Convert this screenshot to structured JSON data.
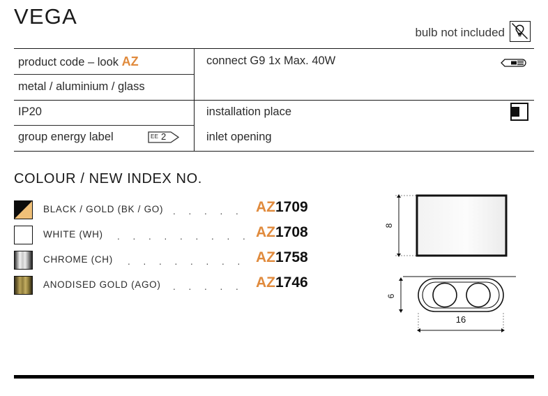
{
  "product": {
    "title": "VEGA",
    "bulb_note": "bulb not included"
  },
  "spec_table": {
    "left_column": [
      {
        "label": "product code – look ",
        "highlight": "AZ"
      },
      {
        "label": "metal / aluminium / glass"
      },
      {
        "label": "IP20"
      },
      {
        "label": "group energy label"
      }
    ],
    "right_column": [
      {
        "label": "connect G9 1x Max. 40W"
      },
      {
        "label": "installation place"
      },
      {
        "label": "inlet opening"
      }
    ],
    "energy_label": {
      "prefix": "EE",
      "value": "2"
    },
    "icons": {
      "bulb_not_included": "bulb-crossed-icon",
      "lamp_socket": "g9-capsule-lamp-icon",
      "installation_place": "wall-mount-icon"
    }
  },
  "colour_section": {
    "heading": "COLOUR / NEW INDEX NO.",
    "rows": [
      {
        "name": "BLACK / GOLD (BK / GO)",
        "swatch": "black-gold-swatch",
        "leader": ". . . . . . .",
        "code_prefix": "AZ",
        "code_number": "1709"
      },
      {
        "name": "WHITE (WH)",
        "swatch": "white-swatch",
        "leader": ". . . . . . . . . . . .",
        "code_prefix": "AZ",
        "code_number": "1708"
      },
      {
        "name": "CHROME (CH)",
        "swatch": "chrome-swatch",
        "leader": ". . . . . . . . . . .",
        "code_prefix": "AZ",
        "code_number": "1758"
      },
      {
        "name": "ANODISED GOLD (AGO)",
        "swatch": "anodised-gold-swatch",
        "leader": ". . . . . . .",
        "code_prefix": "AZ",
        "code_number": "1746"
      }
    ]
  },
  "technical_drawings": {
    "front_view": {
      "height_label": "8"
    },
    "bottom_view": {
      "height_label": "6",
      "width_label": "16"
    }
  },
  "colors": {
    "accent_orange": "#e08a3c",
    "ink": "#1a1a1a",
    "rule": "#1a1a1a"
  }
}
